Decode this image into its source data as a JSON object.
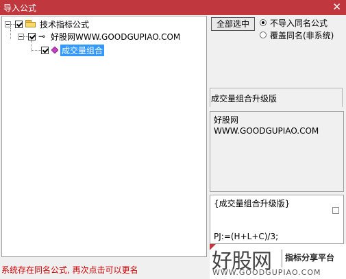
{
  "window": {
    "title": "导入公式",
    "close_glyph": "✕"
  },
  "tree": {
    "root_label": "技术指标公式",
    "group_label": "好股网WWW.GOODGUPIAO.COM",
    "item_label": "成交量组合"
  },
  "actions": {
    "select_all_label": "全部选中",
    "radio_options": [
      {
        "label": "不导入同名公式",
        "selected": true
      },
      {
        "label": "覆盖同名(非系统)",
        "selected": false
      }
    ]
  },
  "details": {
    "formula_name": "成交量组合升级版",
    "description_lines": [
      "好股网",
      "WWW.GOODGUPIAO.COM"
    ],
    "code_lines": [
      "{成交量组合升级版}",
      "",
      "",
      "PJ:=(H+L+C)/3;"
    ]
  },
  "status_message": "系统存在同名公式, 再次点击可以更名",
  "watermark": {
    "brand": "好股网",
    "tagline": "指标分享平台",
    "url": "WWW.GOODGUPIAO.COM"
  },
  "colors": {
    "titlebar": "#c0383e",
    "selection": "#3399ff",
    "status_text": "#d00000"
  }
}
